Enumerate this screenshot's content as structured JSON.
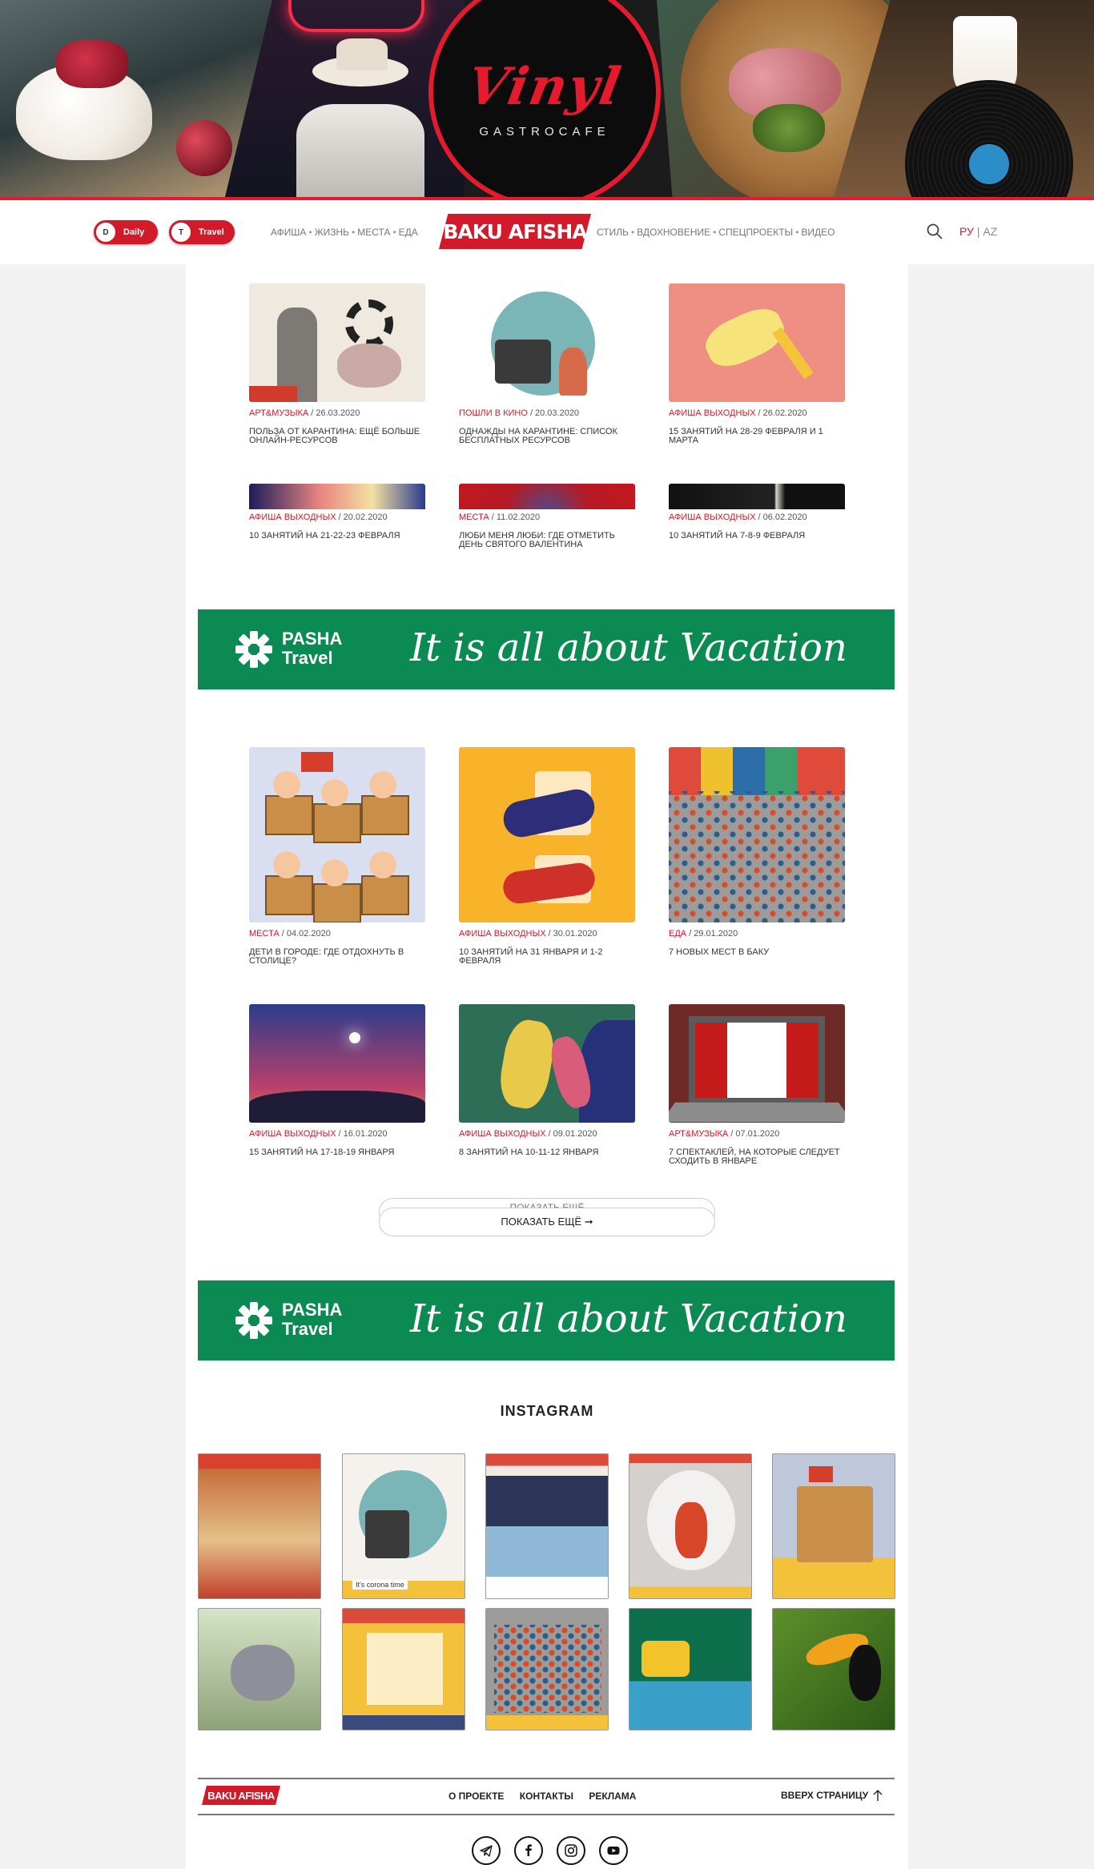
{
  "banner": {
    "brand": "Vinyl",
    "subtitle": "GASTROCAFE"
  },
  "header": {
    "toggles": [
      {
        "knob": "D",
        "label": "Daily"
      },
      {
        "knob": "T",
        "label": "Travel"
      }
    ],
    "nav_left": [
      "АФИША",
      "ЖИЗНЬ",
      "МЕСТА",
      "ЕДА"
    ],
    "nav_right": [
      "СТИЛЬ",
      "ВДОХНОВЕНИЕ",
      "СПЕЦПРОЕКТЫ",
      "ВИДЕО"
    ],
    "separator": "•",
    "logo": "BAKU AFISHA",
    "languages": {
      "ru": "РУ",
      "divider": "|",
      "az": "AZ"
    }
  },
  "articles_top": [
    {
      "category": "АРТ&МУЗЫКА",
      "date": "26.03.2020",
      "title": "ПОЛЬЗА ОТ КАРАНТИНА: ЕЩЁ БОЛЬШЕ ОНЛАЙН-РЕСУРСОВ"
    },
    {
      "category": "ПОШЛИ В КИНО",
      "date": "20.03.2020",
      "title": "ОДНАЖДЫ НА КАРАНТИНЕ: СПИСОК БЕСПЛАТНЫХ РЕСУРСОВ"
    },
    {
      "category": "АФИША ВЫХОДНЫХ",
      "date": "26.02.2020",
      "title": "15 ЗАНЯТИЙ НА 28-29 ФЕВРАЛЯ И 1 МАРТА"
    },
    {
      "category": "АФИША ВЫХОДНЫХ",
      "date": "20.02.2020",
      "title": "10 ЗАНЯТИЙ НА 21-22-23 ФЕВРАЛЯ"
    },
    {
      "category": "МЕСТА",
      "date": "11.02.2020",
      "title": "ЛЮБИ МЕНЯ ЛЮБИ: ГДЕ ОТМЕТИТЬ ДЕНЬ СВЯТОГО ВАЛЕНТИНА"
    },
    {
      "category": "АФИША ВЫХОДНЫХ",
      "date": "06.02.2020",
      "title": "10 ЗАНЯТИЙ НА 7-8-9 ФЕВРАЛЯ"
    }
  ],
  "ad": {
    "brand_line1": "PASHA",
    "brand_line2": "Travel",
    "slogan": "It is all about Vacation"
  },
  "articles_bottom": [
    {
      "category": "МЕСТА",
      "date": "04.02.2020",
      "title": "ДЕТИ В ГОРОДЕ: ГДЕ ОТДОХНУТЬ В СТОЛИЦЕ?"
    },
    {
      "category": "АФИША ВЫХОДНЫХ",
      "date": "30.01.2020",
      "title": "10 ЗАНЯТИЙ НА 31 ЯНВАРЯ И 1-2 ФЕВРАЛЯ"
    },
    {
      "category": "ЕДА",
      "date": "29.01.2020",
      "title": "7 НОВЫХ МЕСТ В БАКУ"
    },
    {
      "category": "АФИША ВЫХОДНЫХ",
      "date": "16.01.2020",
      "title": "15 ЗАНЯТИЙ НА 17-18-19 ЯНВАРЯ"
    },
    {
      "category": "АФИША ВЫХОДНЫХ",
      "date": "09.01.2020",
      "title": "8 ЗАНЯТИЙ НА 10-11-12 ЯНВАРЯ"
    },
    {
      "category": "АРТ&МУЗЫКА",
      "date": "07.01.2020",
      "title": "7 СПЕКТАКЛЕЙ, НА КОТОРЫЕ СЛЕДУЕТ СХОДИТЬ В ЯНВАРЕ"
    }
  ],
  "load_more": {
    "ghost_label": "ПОКАЗАТЬ ЕЩЁ",
    "label": "ПОКАЗАТЬ ЕЩЁ ➞"
  },
  "instagram": {
    "title": "INSTAGRAM",
    "caption_2": "It's corona time"
  },
  "footer": {
    "logo": "BAKU AFISHA",
    "links": [
      "О ПРОЕКТЕ",
      "КОНТАКТЫ",
      "РЕКЛАМА"
    ],
    "back_to_top": "ВВЕРХ СТРАНИЦУ"
  },
  "colors": {
    "accent": "#d11a2a",
    "ad_green": "#0c8a53"
  }
}
